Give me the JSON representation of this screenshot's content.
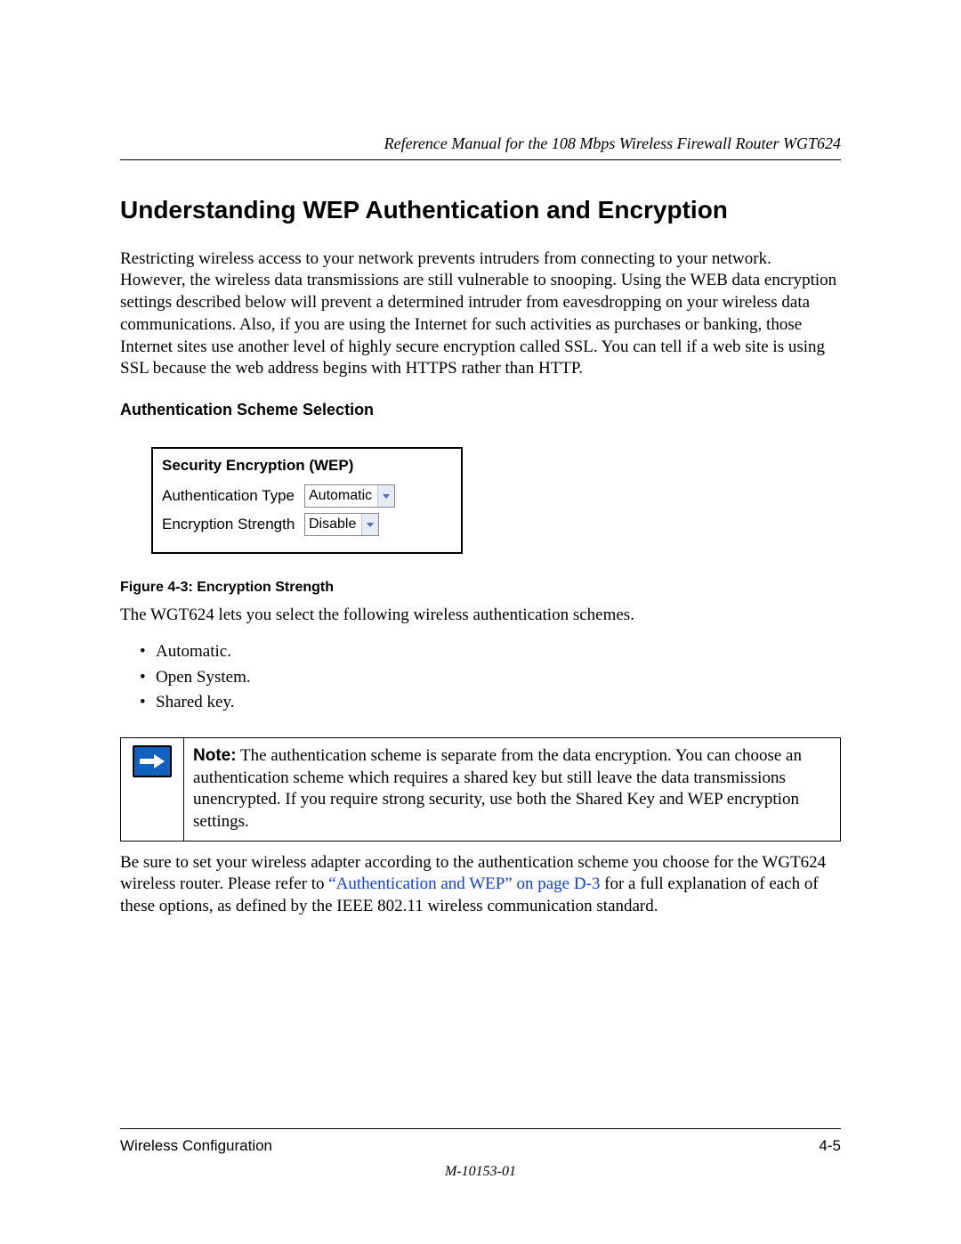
{
  "header": {
    "running": "Reference Manual for the 108 Mbps Wireless Firewall Router WGT624"
  },
  "title": "Understanding WEP Authentication and Encryption",
  "intro": "Restricting wireless access to your network prevents intruders from connecting to your network. However, the wireless data transmissions are still vulnerable to snooping. Using the WEB data encryption settings described below will prevent a determined intruder from eavesdropping on your wireless data communications. Also, if you are using the Internet for such activities as purchases or banking, those Internet sites use another level of highly secure encryption called SSL. You can tell if a web site is using SSL because the web address begins with HTTPS rather than HTTP.",
  "subhead": "Authentication Scheme Selection",
  "wep_box": {
    "title": "Security Encryption (WEP)",
    "row1_label": "Authentication Type",
    "row1_value": "Automatic",
    "row2_label": "Encryption Strength",
    "row2_value": "Disable"
  },
  "figure_caption": "Figure 4-3:  Encryption Strength",
  "lead": "The WGT624 lets you select the following wireless authentication schemes.",
  "schemes": [
    "Automatic.",
    "Open System.",
    "Shared key."
  ],
  "note": {
    "label": "Note:",
    "text": " The authentication scheme is separate from the data encryption. You can choose an authentication scheme which requires a shared key but still leave the data transmissions unencrypted. If you require strong security, use both the Shared Key and WEP encryption settings."
  },
  "closing": {
    "pre": "Be sure to set your wireless adapter according to the authentication scheme you choose for the WGT624 wireless router. Please refer to ",
    "xref": "“Authentication and WEP” on page D-3",
    "post": " for a full explanation of each of these options, as defined by the IEEE 802.11 wireless communication standard."
  },
  "footer": {
    "left": "Wireless Configuration",
    "right": "4-5",
    "docnum": "M-10153-01"
  }
}
